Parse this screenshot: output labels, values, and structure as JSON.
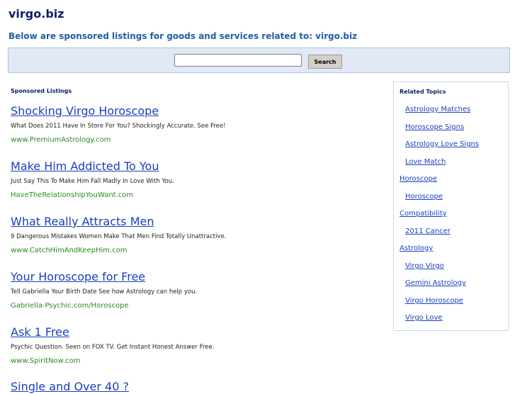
{
  "site_title": "virgo.biz",
  "subtitle": "Below are sponsored listings for goods and services related to: virgo.biz",
  "search": {
    "value": "",
    "placeholder": "",
    "button_label": "Search"
  },
  "listings_heading": "Sponsored Listings",
  "listings": [
    {
      "title": "Shocking Virgo Horoscope",
      "description": "What Does 2011 Have In Store For You? Shockingly Accurate. See Free!",
      "url": "www.PremiumAstrology.com"
    },
    {
      "title": "Make Him Addicted To You",
      "description": "Just Say This To Make Him Fall Madly In Love With You.",
      "url": "HaveTheRelationshipYouWant.com"
    },
    {
      "title": "What Really Attracts Men",
      "description": "9 Dangerous Mistakes Women Make That Men Find Totally Unattractive.",
      "url": "www.CatchHimAndKeepHim.com"
    },
    {
      "title": "Your Horoscope for Free",
      "description": "Tell Gabriella Your Birth Date See how Astrology can help you.",
      "url": "Gabriella-Psychic.com/Horoscope"
    },
    {
      "title": "Ask 1 Free",
      "description": "Psychic Question. Seen on FOX TV. Get Instant Honest Answer Free.",
      "url": "www.SpiritNow.com"
    },
    {
      "title": "Single and Over 40 ?",
      "description": "",
      "url": ""
    }
  ],
  "related": {
    "heading": "Related Topics",
    "links": [
      {
        "label": "Astrology Matches",
        "level": "child"
      },
      {
        "label": "Horoscope Signs",
        "level": "child"
      },
      {
        "label": "Astrology Love Signs",
        "level": "child"
      },
      {
        "label": "Love Match",
        "level": "child"
      },
      {
        "label": "Horoscope",
        "level": "parent"
      },
      {
        "label": "Horoscope",
        "level": "child"
      },
      {
        "label": "Compatibility",
        "level": "parent"
      },
      {
        "label": "2011 Cancer",
        "level": "child"
      },
      {
        "label": "Astrology",
        "level": "parent"
      },
      {
        "label": "Virgo Virgo",
        "level": "child"
      },
      {
        "label": "Gemini Astrology",
        "level": "child"
      },
      {
        "label": "Virgo Horoscope",
        "level": "child"
      },
      {
        "label": "Virgo Love",
        "level": "child"
      }
    ]
  },
  "colors": {
    "title": "#0b1f63",
    "subtitle": "#1f5fa8",
    "link": "#1a3fbf",
    "url": "#2b8a1f",
    "search_bar_bg": "#e1e9f6"
  }
}
